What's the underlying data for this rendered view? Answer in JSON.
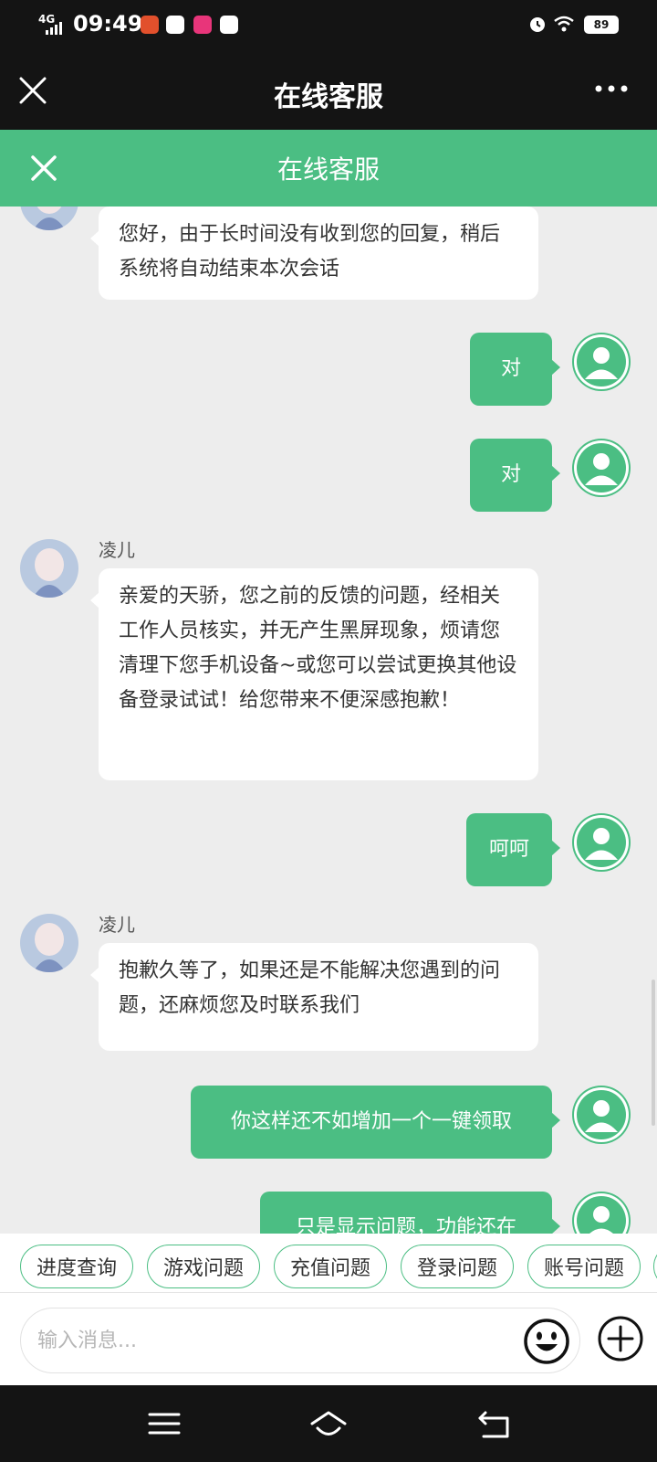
{
  "status_bar": {
    "network": "4G",
    "time": "09:49",
    "battery": "89"
  },
  "title_bar": {
    "title": "在线客服"
  },
  "page_header": {
    "title": "在线客服"
  },
  "messages": [
    {
      "sender": "agent",
      "name": "",
      "text": "您好，由于长时间没有收到您的回复，稍后系统将自动结束本次会话"
    },
    {
      "sender": "user",
      "text": "对"
    },
    {
      "sender": "user",
      "text": "对"
    },
    {
      "sender": "agent",
      "name": "凌儿",
      "text": "亲爱的天骄，您之前的反馈的问题，经相关工作人员核实，并无产生黑屏现象，烦请您清理下您手机设备~或您可以尝试更换其他设备登录试试！给您带来不便深感抱歉！"
    },
    {
      "sender": "user",
      "text": "呵呵"
    },
    {
      "sender": "agent",
      "name": "凌儿",
      "text": "抱歉久等了，如果还是不能解决您遇到的问题，还麻烦您及时联系我们"
    },
    {
      "sender": "user",
      "text": "你这样还不如增加一个一键领取"
    },
    {
      "sender": "user",
      "text": "只是显示问题，功能还在"
    }
  ],
  "quick_topics": [
    "进度查询",
    "游戏问题",
    "充值问题",
    "登录问题",
    "账号问题"
  ],
  "input": {
    "placeholder": "输入消息..."
  },
  "colors": {
    "accent": "#4bbe83",
    "dark_bar": "#141414",
    "chat_bg": "#ededed"
  },
  "icons": [
    "close-icon",
    "more-icon",
    "emoji-icon",
    "plus-icon",
    "menu-icon",
    "home-icon",
    "back-icon"
  ]
}
